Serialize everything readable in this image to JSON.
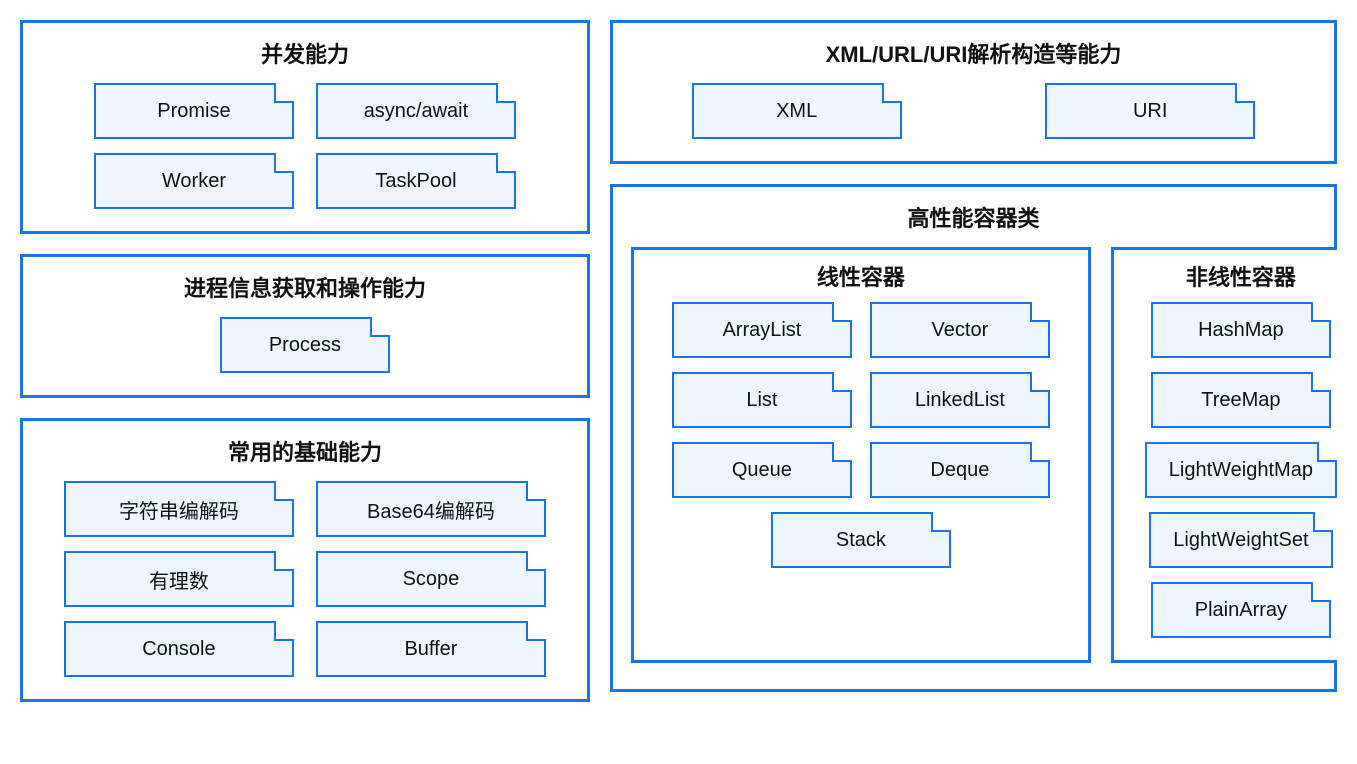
{
  "left": {
    "concurrency": {
      "title": "并发能力",
      "items": [
        "Promise",
        "async/await",
        "Worker",
        "TaskPool"
      ]
    },
    "process": {
      "title": "进程信息获取和操作能力",
      "items": [
        "Process"
      ]
    },
    "basic": {
      "title": "常用的基础能力",
      "items": [
        "字符串编解码",
        "Base64编解码",
        "有理数",
        "Scope",
        "Console",
        "Buffer"
      ]
    }
  },
  "right": {
    "parsing": {
      "title": "XML/URL/URI解析构造等能力",
      "items": [
        "XML",
        "URI"
      ]
    },
    "containers": {
      "title": "高性能容器类",
      "linear": {
        "title": "线性容器",
        "items": [
          "ArrayList",
          "Vector",
          "List",
          "LinkedList",
          "Queue",
          "Deque",
          "Stack"
        ]
      },
      "nonlinear": {
        "title": "非线性容器",
        "items": [
          "HashMap",
          "TreeMap",
          "LightWeightMap",
          "LightWeightSet",
          "PlainArray"
        ]
      }
    }
  }
}
